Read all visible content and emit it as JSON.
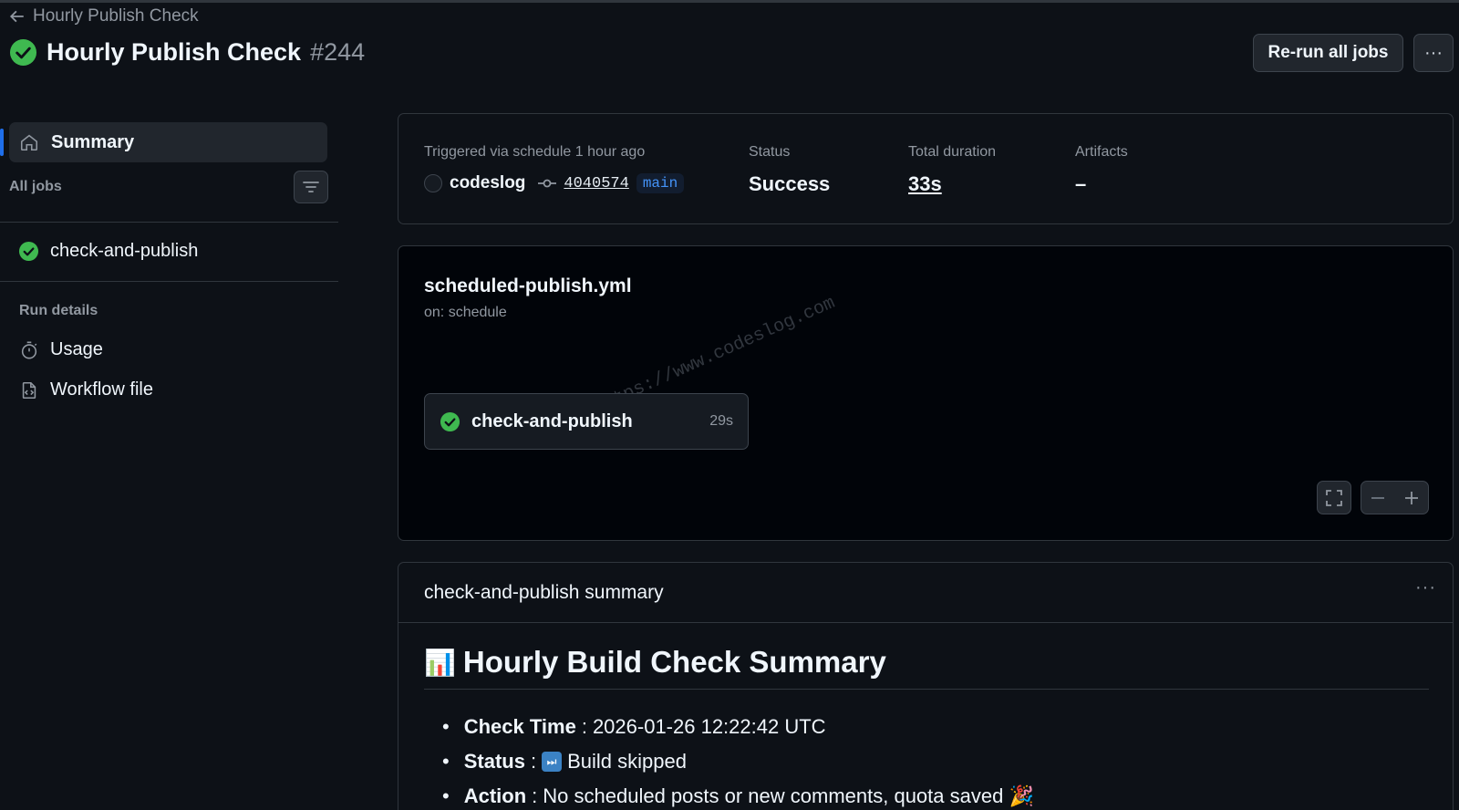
{
  "header": {
    "back_label": "Hourly Publish Check",
    "title": "Hourly Publish Check",
    "run_number": "#244",
    "rerun_label": "Re-run all jobs",
    "more_label": "···"
  },
  "sidebar": {
    "summary_label": "Summary",
    "all_jobs_label": "All jobs",
    "jobs": [
      {
        "label": "check-and-publish",
        "status": "success"
      }
    ],
    "run_details_label": "Run details",
    "links": [
      {
        "label": "Usage",
        "icon": "stopwatch-icon"
      },
      {
        "label": "Workflow file",
        "icon": "file-code-icon"
      }
    ]
  },
  "run_info": {
    "trigger_label": "Triggered via schedule 1 hour ago",
    "actor": "codeslog",
    "commit": "4040574",
    "branch": "main",
    "status_label": "Status",
    "status_value": "Success",
    "duration_label": "Total duration",
    "duration_value": "33s",
    "artifacts_label": "Artifacts",
    "artifacts_value": "–"
  },
  "workflow": {
    "file": "scheduled-publish.yml",
    "trigger": "on: schedule",
    "job_name": "check-and-publish",
    "job_duration": "29s",
    "watermark": "https://www.codeslog.com"
  },
  "job_summary": {
    "title": "check-and-publish summary",
    "heading_emoji": "📊",
    "heading": "Hourly Build Check Summary",
    "items": [
      {
        "key": "Check Time",
        "value": "2026-01-26 12:22:42 UTC"
      },
      {
        "key": "Status",
        "emoji": "⏭",
        "value": "Build skipped"
      },
      {
        "key": "Action",
        "value": "No scheduled posts or new comments, quota saved 🎉"
      }
    ]
  },
  "colors": {
    "success": "#3fb950",
    "accent": "#1f6feb",
    "background": "#0d1117"
  }
}
